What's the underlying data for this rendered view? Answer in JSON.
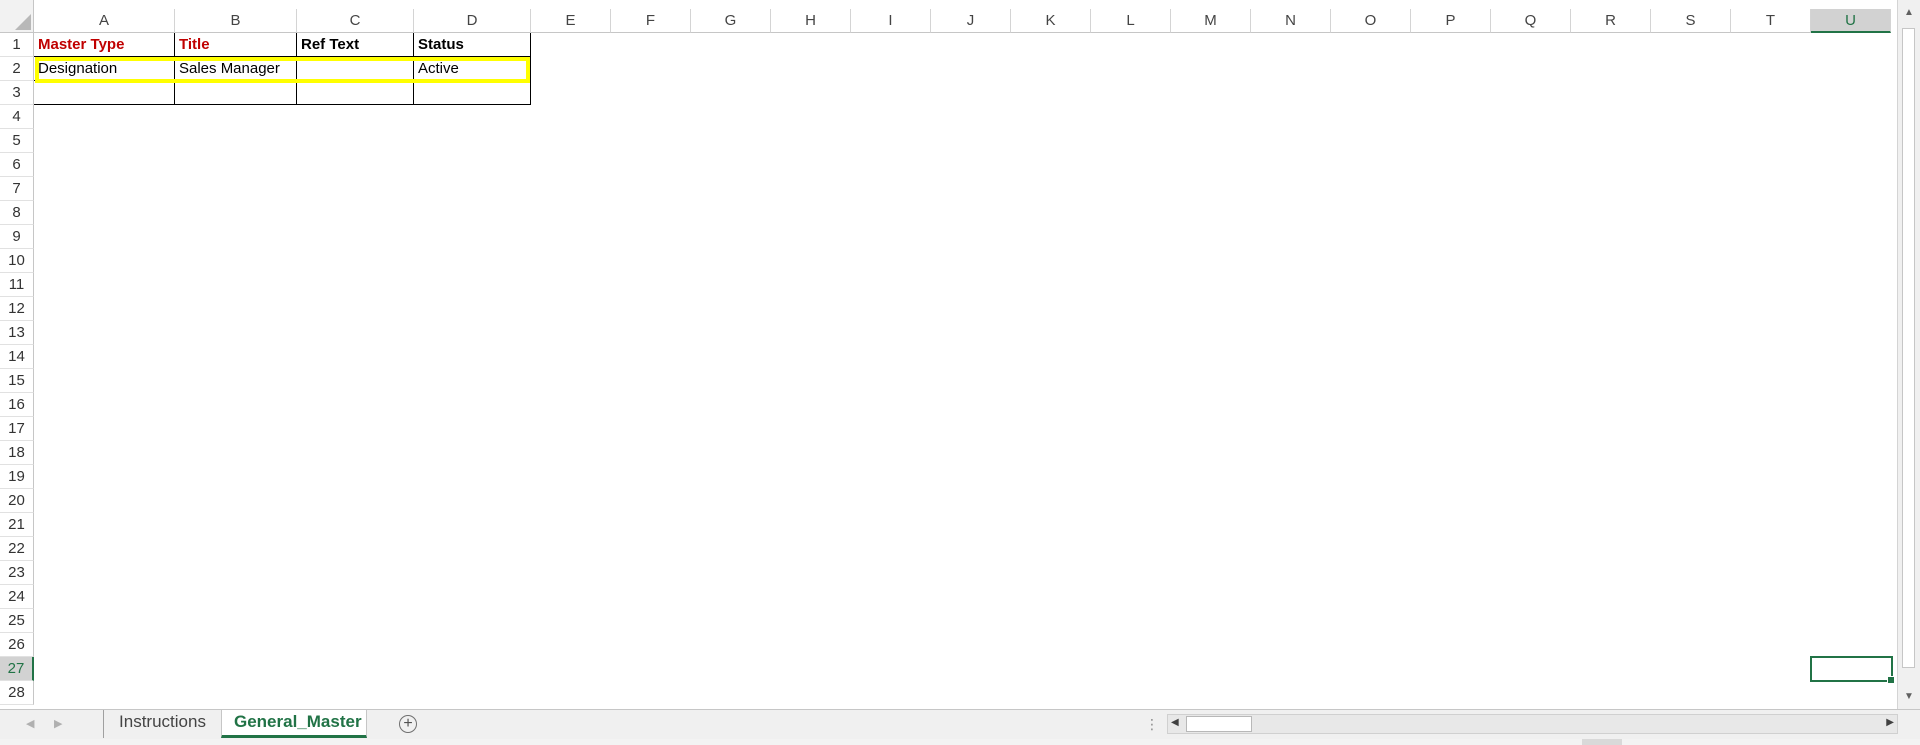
{
  "columns": [
    "A",
    "B",
    "C",
    "D",
    "E",
    "F",
    "G",
    "H",
    "I",
    "J",
    "K",
    "L",
    "M",
    "N",
    "O",
    "P",
    "Q",
    "R",
    "S",
    "T",
    "U"
  ],
  "active_column": "U",
  "rows": [
    "1",
    "2",
    "3",
    "4",
    "5",
    "6",
    "7",
    "8",
    "9",
    "10",
    "11",
    "12",
    "13",
    "14",
    "15",
    "16",
    "17",
    "18",
    "19",
    "20",
    "21",
    "22",
    "23",
    "24",
    "25",
    "26",
    "27",
    "28"
  ],
  "active_row": "27",
  "table": {
    "headers": [
      "Master Type",
      "Title",
      "Ref Text",
      "Status"
    ],
    "rows": [
      [
        "Designation",
        "Sales Manager",
        "",
        "Active"
      ],
      [
        "",
        "",
        "",
        ""
      ]
    ]
  },
  "highlighted_row": "2",
  "selected_cell": "U27",
  "sheets": [
    "Instructions",
    "General_Master"
  ],
  "active_sheet": "General_Master",
  "icons": {
    "select_all": "select-all-triangle-icon",
    "add_sheet": "add-sheet-plus-icon",
    "scroll_left": "triangle-left-icon",
    "scroll_right": "triangle-right-icon",
    "scroll_up": "triangle-up-icon",
    "scroll_down": "triangle-down-icon"
  },
  "colors": {
    "accent": "#217346",
    "required_header": "#c00000",
    "highlight": "#ffff00"
  }
}
